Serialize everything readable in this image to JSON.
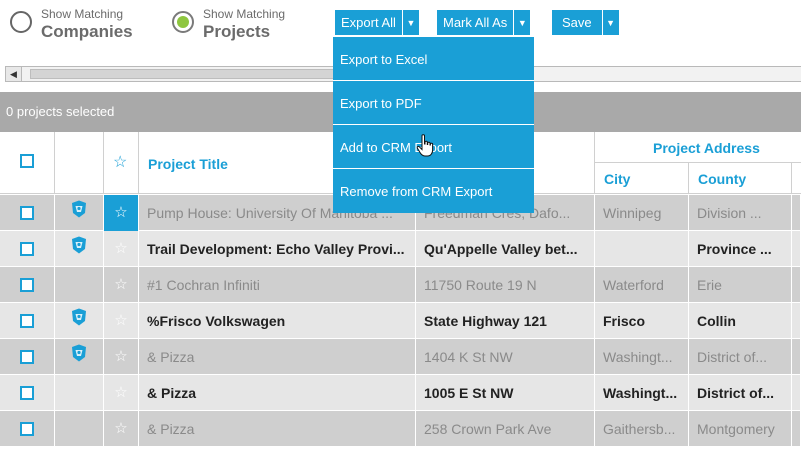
{
  "toggles": [
    {
      "small": "Show Matching",
      "big": "Companies",
      "selected": false
    },
    {
      "small": "Show Matching",
      "big": "Projects",
      "selected": true
    }
  ],
  "toolbar": {
    "export_all": "Export All",
    "mark_all_as": "Mark All As",
    "save": "Save",
    "caret": "▼",
    "accent": "#1a9fd6"
  },
  "menu": {
    "items": [
      "Export to Excel",
      "Export to PDF",
      "Add to CRM Export",
      "Remove from CRM Export"
    ]
  },
  "scroll_arrow": "◀",
  "selection": {
    "text": "0 projects selected"
  },
  "headers": {
    "project_title": "Project Title",
    "project_address": "Project Address",
    "city": "City",
    "county": "County",
    "star": "☆"
  },
  "rows": [
    {
      "style": "gray",
      "crm": true,
      "starred": true,
      "title": "Pump House: University Of Manitoba ...",
      "address": "Freedman Cres, Dafo...",
      "city": "Winnipeg",
      "county": "Division ..."
    },
    {
      "style": "light",
      "crm": true,
      "starred": false,
      "title": "Trail Development: Echo Valley Provi...",
      "address": "Qu'Appelle Valley bet...",
      "city": "",
      "county": "Province ..."
    },
    {
      "style": "gray",
      "crm": false,
      "starred": false,
      "title": "#1 Cochran Infiniti",
      "address": "11750 Route 19 N",
      "city": "Waterford",
      "county": "Erie"
    },
    {
      "style": "light",
      "crm": true,
      "starred": false,
      "title": "%Frisco Volkswagen",
      "address": "State Highway 121",
      "city": "Frisco",
      "county": "Collin"
    },
    {
      "style": "gray",
      "crm": true,
      "starred": false,
      "title": "& Pizza",
      "address": "1404 K St NW",
      "city": "Washingt...",
      "county": "District of..."
    },
    {
      "style": "light",
      "crm": false,
      "starred": false,
      "title": "& Pizza",
      "address": "1005 E St NW",
      "city": "Washingt...",
      "county": "District of..."
    },
    {
      "style": "gray",
      "crm": false,
      "starred": false,
      "title": "& Pizza",
      "address": "258 Crown Park Ave",
      "city": "Gaithersb...",
      "county": "Montgomery"
    }
  ]
}
